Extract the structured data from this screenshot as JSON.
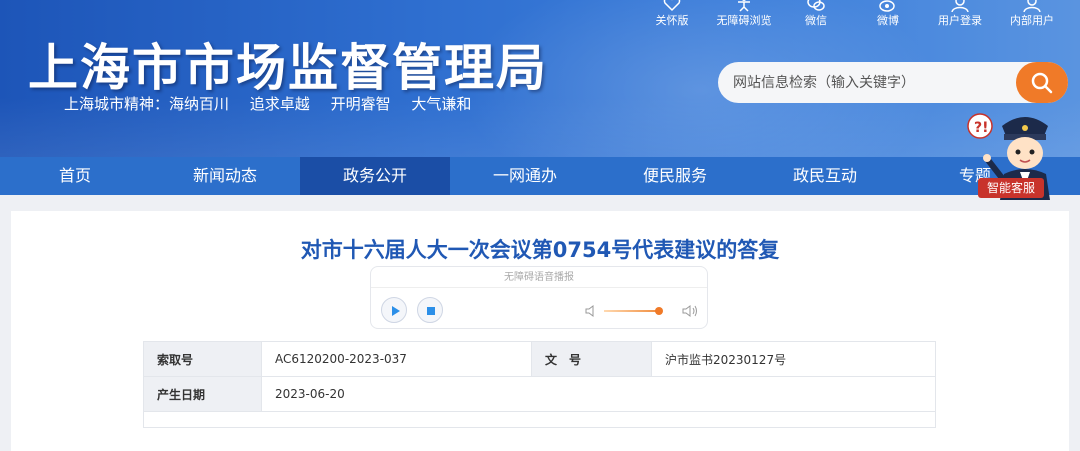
{
  "header": {
    "site_title": "上海市市场监督管理局",
    "slogan": [
      "上海城市精神：海纳百川",
      "追求卓越",
      "开明睿智",
      "大气谦和"
    ],
    "tools": [
      {
        "label": "关怀版",
        "icon": "care-icon"
      },
      {
        "label": "无障碍浏览",
        "icon": "accessibility-icon"
      },
      {
        "label": "微信",
        "icon": "wechat-icon"
      },
      {
        "label": "微博",
        "icon": "weibo-icon"
      },
      {
        "label": "用户登录",
        "icon": "user-icon"
      },
      {
        "label": "内部用户",
        "icon": "internal-user-icon"
      }
    ],
    "search": {
      "placeholder": "网站信息检索（输入关键字）"
    },
    "colors": {
      "accent": "#f07a28",
      "nav_bg": "#2c6fcb",
      "nav_active": "#1b4ea6",
      "title": "#2058b4"
    }
  },
  "nav": {
    "items": [
      "首页",
      "新闻动态",
      "政务公开",
      "一网通办",
      "便民服务",
      "政民互动",
      "专题"
    ],
    "active": "政务公开"
  },
  "assistant": {
    "label": "智能客服"
  },
  "article": {
    "title": "对市十六届人大一次会议第0754号代表建议的答复",
    "player": {
      "label": "无障碍语音播报"
    },
    "meta": {
      "index_label": "索取号",
      "index_value": "AC6120200-2023-037",
      "doc_label": "文　号",
      "doc_value": "沪市监书20230127号",
      "date_label": "产生日期",
      "date_value": "2023-06-20"
    }
  }
}
